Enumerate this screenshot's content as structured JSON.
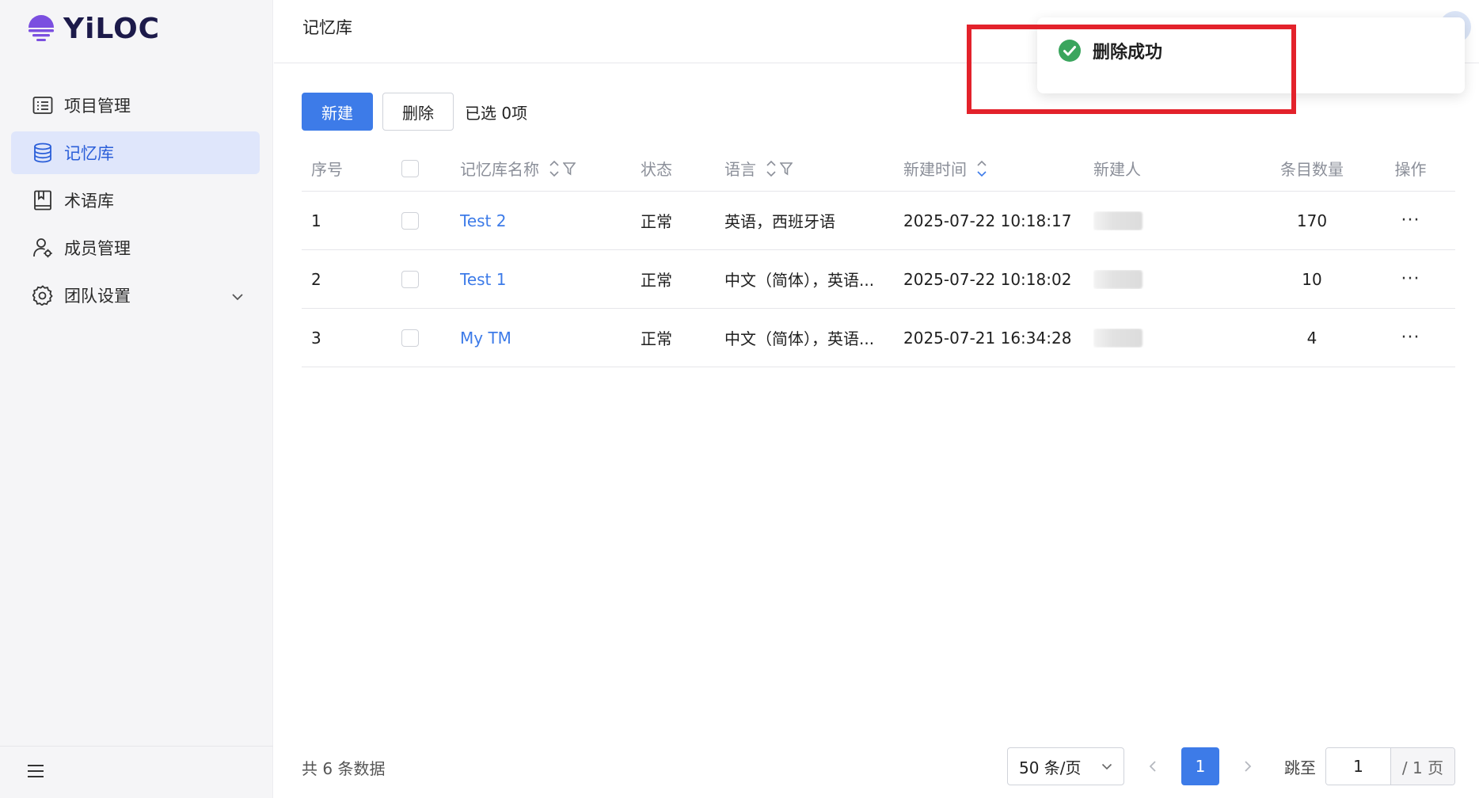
{
  "app": {
    "logo_text": "YiLOC"
  },
  "sidebar": {
    "items": [
      {
        "label": "项目管理",
        "icon": "list-icon",
        "active": false
      },
      {
        "label": "记忆库",
        "icon": "database-icon",
        "active": true
      },
      {
        "label": "术语库",
        "icon": "book-icon",
        "active": false
      },
      {
        "label": "成员管理",
        "icon": "user-gear-icon",
        "active": false
      },
      {
        "label": "团队设置",
        "icon": "gear-icon",
        "active": false
      }
    ]
  },
  "header": {
    "title": "记忆库"
  },
  "toolbar": {
    "new_label": "新建",
    "delete_label": "删除",
    "selected_text": "已选 0项"
  },
  "table": {
    "columns": [
      "序号",
      "记忆库名称",
      "状态",
      "语言",
      "新建时间",
      "新建人",
      "条目数量",
      "操作"
    ],
    "rows": [
      {
        "idx": "1",
        "name": "Test 2",
        "status": "正常",
        "lang": "英语，西班牙语",
        "created": "2025-07-22 10:18:17",
        "count": "170"
      },
      {
        "idx": "2",
        "name": "Test 1",
        "status": "正常",
        "lang": "中文（简体），英语...",
        "created": "2025-07-22 10:18:02",
        "count": "10"
      },
      {
        "idx": "3",
        "name": "My TM",
        "status": "正常",
        "lang": "中文（简体），英语...",
        "created": "2025-07-21 16:34:28",
        "count": "4"
      }
    ]
  },
  "footer": {
    "total_text": "共 6 条数据",
    "page_size": "50 条/页",
    "current_page": "1",
    "jump_label": "跳至",
    "jump_value": "1",
    "total_pages": "/ 1 页"
  },
  "toast": {
    "message": "删除成功",
    "type": "success"
  },
  "colors": {
    "accent": "#3d7be8",
    "success": "#3aa55d",
    "highlight": "#e3222b",
    "active_bg": "#dfe6fb"
  }
}
